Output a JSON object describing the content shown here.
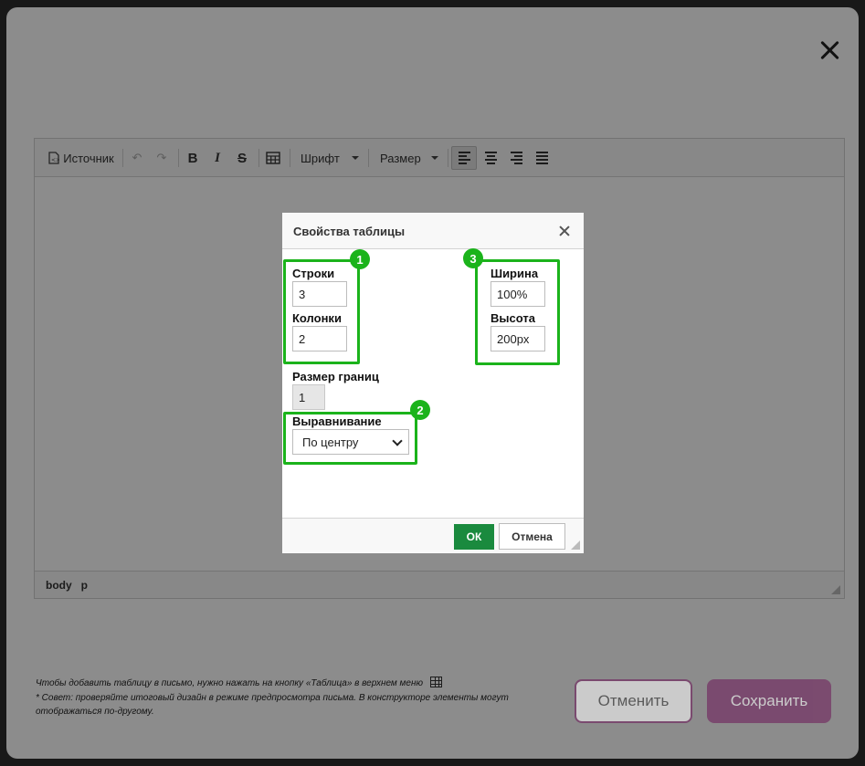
{
  "toolbar": {
    "source_label": "Источник",
    "font_label": "Шрифт",
    "size_label": "Размер",
    "bold_label": "B",
    "italic_label": "I",
    "strike_label": "S"
  },
  "editor_footer": {
    "path": [
      "body",
      "p"
    ]
  },
  "dialog": {
    "title": "Свойства таблицы",
    "rows_label": "Строки",
    "rows_value": "3",
    "cols_label": "Колонки",
    "cols_value": "2",
    "border_label": "Размер границ",
    "border_value": "1",
    "align_label": "Выравнивание",
    "align_value": "По центру",
    "width_label": "Ширина",
    "width_value": "100%",
    "height_label": "Высота",
    "height_value": "200px",
    "ok_label": "ОК",
    "cancel_label": "Отмена"
  },
  "badges": [
    "1",
    "2",
    "3"
  ],
  "notes": {
    "line1": "Чтобы добавить таблицу в письмо, нужно нажать на кнопку «Таблица» в верхнем меню",
    "line2": "* Совет: проверяйте итоговый дизайн в режиме предпросмотра письма. В конструкторе элементы могут",
    "line3": "отображаться по-другому."
  },
  "actions": {
    "cancel_label": "Отменить",
    "save_label": "Сохранить"
  },
  "colors": {
    "accent": "#6d1558",
    "ok_green": "#1a8a3e",
    "highlight_green": "#1bb31b"
  }
}
